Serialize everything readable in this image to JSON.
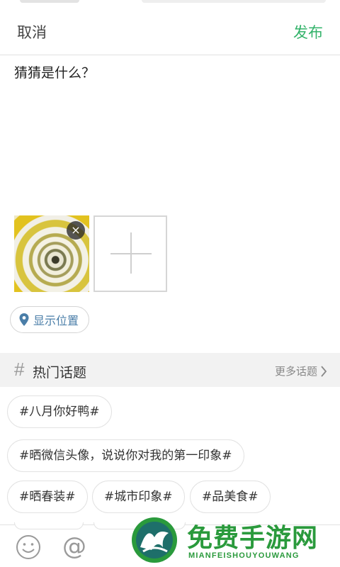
{
  "header": {
    "cancel_label": "取消",
    "publish_label": "发布"
  },
  "post": {
    "text": "猜猜是什么？"
  },
  "photos": {
    "remove_symbol": "×",
    "add_icon": "plus-icon"
  },
  "location": {
    "label": "显示位置",
    "icon": "location-pin-icon"
  },
  "topics": {
    "hash_symbol": "#",
    "title": "热门话题",
    "more_label": "更多话题",
    "tags": [
      "#八月你好鸭#",
      "#晒微信头像，说说你对我的第一印象#",
      "#晒春装#",
      "#城市印象#",
      "#品美食#"
    ]
  },
  "toolbar": {
    "emoji_icon": "smiley-icon",
    "at_symbol": "@"
  },
  "watermark": {
    "title": "免费手游网",
    "subtitle": "MIANFEISHOUYOUWANG"
  },
  "colors": {
    "accent": "#33b36a",
    "link": "#4a7ea8",
    "watermark": "#2a9a3c"
  }
}
